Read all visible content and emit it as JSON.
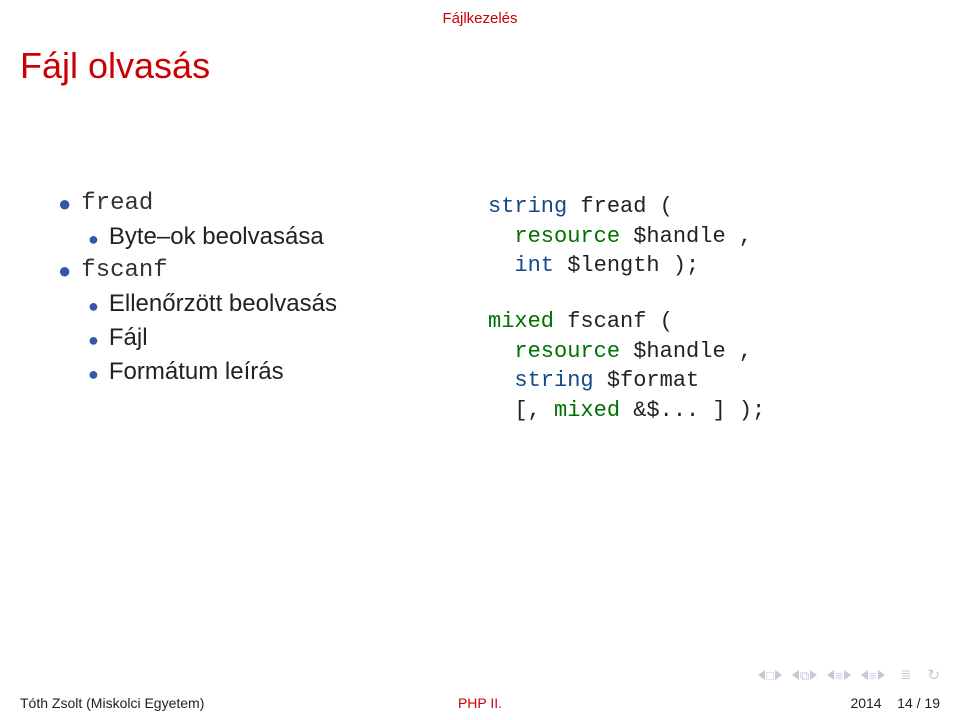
{
  "section_label": "Fájlkezelés",
  "title": "Fájl olvasás",
  "left": {
    "items": [
      {
        "level": 1,
        "kind": "tt",
        "text": "fread"
      },
      {
        "level": 2,
        "kind": "body",
        "text": "Byte–ok beolvasása"
      },
      {
        "level": 1,
        "kind": "tt",
        "text": "fscanf"
      },
      {
        "level": 2,
        "kind": "body",
        "text": "Ellenőrzött beolvasás"
      },
      {
        "level": 2,
        "kind": "body",
        "text": "Fájl"
      },
      {
        "level": 2,
        "kind": "body",
        "text": "Formátum leírás"
      }
    ]
  },
  "code": {
    "block1": [
      [
        {
          "c": "blue",
          "t": "string"
        },
        {
          "c": "plain",
          "t": " fread ("
        }
      ],
      [
        {
          "c": "plain",
          "t": "  "
        },
        {
          "c": "green",
          "t": "resource"
        },
        {
          "c": "plain",
          "t": " $handle ,"
        }
      ],
      [
        {
          "c": "plain",
          "t": "  "
        },
        {
          "c": "blue",
          "t": "int"
        },
        {
          "c": "plain",
          "t": " $length );"
        }
      ]
    ],
    "block2": [
      [
        {
          "c": "green",
          "t": "mixed"
        },
        {
          "c": "plain",
          "t": " fscanf ("
        }
      ],
      [
        {
          "c": "plain",
          "t": "  "
        },
        {
          "c": "green",
          "t": "resource"
        },
        {
          "c": "plain",
          "t": " $handle ,"
        }
      ],
      [
        {
          "c": "plain",
          "t": "  "
        },
        {
          "c": "blue",
          "t": "string"
        },
        {
          "c": "plain",
          "t": " $format"
        }
      ],
      [
        {
          "c": "plain",
          "t": "  [, "
        },
        {
          "c": "green",
          "t": "mixed"
        },
        {
          "c": "plain",
          "t": " &$... ] );"
        }
      ]
    ]
  },
  "footer": {
    "author": "Tóth Zsolt (Miskolci Egyetem)",
    "center": "PHP II.",
    "year": "2014",
    "page": "14 / 19"
  }
}
